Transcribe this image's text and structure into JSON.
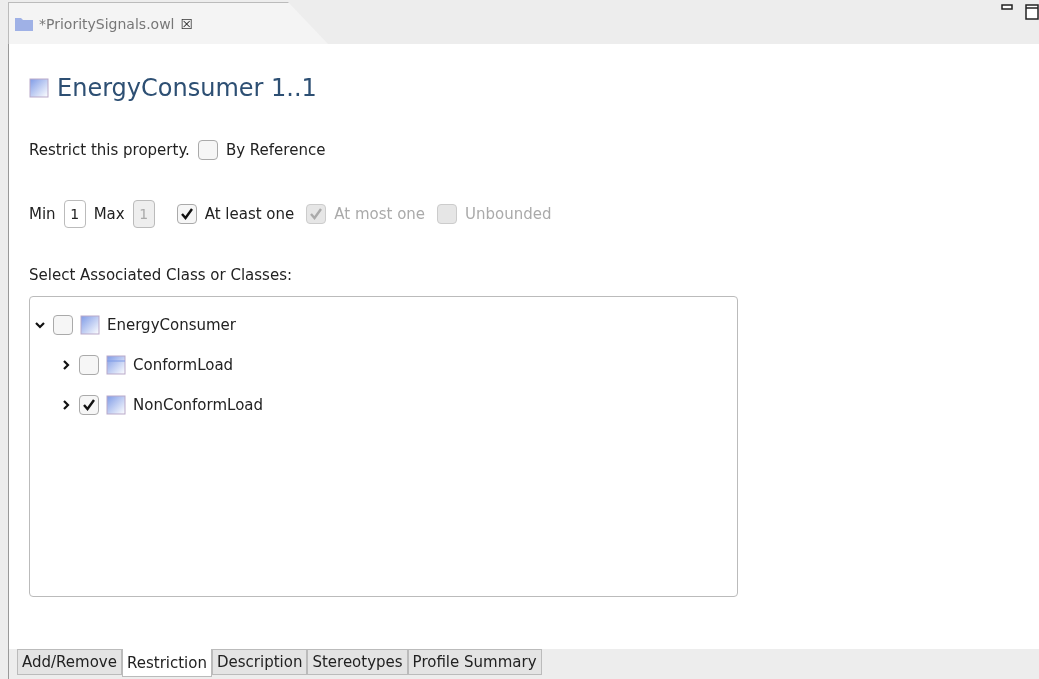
{
  "editor_tab": {
    "title": "*PrioritySignals.owl",
    "close": "☒"
  },
  "heading": "EnergyConsumer 1..1",
  "restrict": {
    "label": "Restrict this property.",
    "by_reference": {
      "label": "By Reference",
      "checked": false
    }
  },
  "cardinality": {
    "min_label": "Min",
    "min": {
      "value": "1",
      "disabled": false
    },
    "max_label": "Max",
    "max": {
      "value": "1",
      "disabled": true
    },
    "options": [
      {
        "label": "At least one",
        "checked": true,
        "disabled": false
      },
      {
        "label": "At most one",
        "checked": true,
        "disabled": true
      },
      {
        "label": "Unbounded",
        "checked": false,
        "disabled": true
      }
    ]
  },
  "classes_label": "Select Associated Class or Classes:",
  "tree": [
    {
      "label": "EnergyConsumer",
      "kind": "class",
      "checked": false,
      "expanded": true,
      "children": [
        {
          "label": "ConformLoad",
          "kind": "table",
          "checked": false,
          "expanded": false
        },
        {
          "label": "NonConformLoad",
          "kind": "class",
          "checked": true,
          "expanded": false
        }
      ]
    }
  ],
  "bottom_tabs": [
    {
      "label": "Add/Remove",
      "selected": false
    },
    {
      "label": "Restriction",
      "selected": true
    },
    {
      "label": "Description",
      "selected": false
    },
    {
      "label": "Stereotypes",
      "selected": false
    },
    {
      "label": "Profile Summary",
      "selected": false
    }
  ]
}
